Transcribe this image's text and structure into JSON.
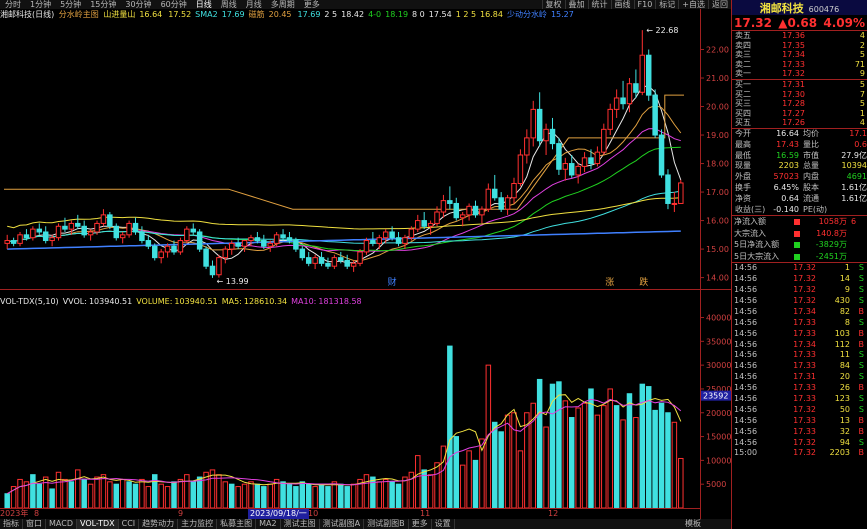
{
  "topbar": {
    "timeframes": [
      "分时",
      "1分钟",
      "5分钟",
      "15分钟",
      "30分钟",
      "60分钟",
      "日线",
      "周线",
      "月线",
      "多周期",
      "更多"
    ],
    "active_index": 6,
    "right_buttons": [
      "复权",
      "叠加",
      "统计",
      "画线",
      "F10",
      "标记",
      "+自选",
      "返回"
    ]
  },
  "legend": {
    "title": "湘邮科技(日线)",
    "indicator": "分水岭主图",
    "items": [
      {
        "label": "山进量山",
        "value": "16.64",
        "color": "#f0e040"
      },
      {
        "label": "",
        "value": "17.52",
        "color": "#f0e040"
      },
      {
        "label": "SMA2",
        "value": "17.69",
        "color": "#40e0e0"
      },
      {
        "label": "磁筋",
        "value": "20.45",
        "color": "#e0a040"
      },
      {
        "label": "",
        "value": "17.69",
        "color": "#40e0e0"
      },
      {
        "label": "2 5",
        "value": "18.42",
        "color": "#e8e8e8"
      },
      {
        "label": "4-0",
        "value": "18.19",
        "color": "#20d020"
      },
      {
        "label": "8 0",
        "value": "17.54",
        "color": "#e8e8e8"
      },
      {
        "label": "1 2 5",
        "value": "16.84",
        "color": "#f0e040"
      },
      {
        "label": "少动分水岭",
        "value": "15.27",
        "color": "#4080ff"
      }
    ]
  },
  "price_axis": [
    "22.00",
    "21.00",
    "20.00",
    "19.00",
    "18.00",
    "17.00",
    "16.00",
    "15.00",
    "14.00"
  ],
  "chart_annotations": {
    "high_label": "22.68",
    "low_label": "13.99"
  },
  "bottom_markers": [
    "财",
    "涨",
    "跌"
  ],
  "volume": {
    "legend": [
      {
        "label": "VOL-TDX(5,10)",
        "value": "",
        "color": "#e8e8e8"
      },
      {
        "label": "VVOL:",
        "value": "103940.51",
        "color": "#e8e8e8"
      },
      {
        "label": "VOLUME:",
        "value": "103940.51",
        "color": "#f0e040"
      },
      {
        "label": "MA5:",
        "value": "128610.34",
        "color": "#f0e040"
      },
      {
        "label": "MA10:",
        "value": "181318.58",
        "color": "#e040e0"
      }
    ],
    "axis": [
      "40000",
      "35000",
      "30000",
      "25000",
      "20000",
      "15000",
      "10000",
      "5000"
    ],
    "highlight": "23592"
  },
  "date_axis": [
    "2023年",
    "8",
    "9",
    "2023/09/18/一",
    "10",
    "11",
    "12"
  ],
  "bottom_tabs": [
    "指标",
    "窗口",
    "MACD",
    "VOL-TDX",
    "CCI",
    "趋势动力",
    "主力监控",
    "私募主图",
    "MA2",
    "测试主图",
    "测试副图A",
    "测试副图B",
    "更多",
    "设置"
  ],
  "bottom_tab_active": 3,
  "bottom_right": "模板",
  "stock": {
    "name": "湘邮科技",
    "code": "600476",
    "price": "17.32",
    "change": "▲0.68",
    "change_pct": "4.09%"
  },
  "asks": [
    {
      "label": "卖五",
      "price": "17.36",
      "vol": "4"
    },
    {
      "label": "卖四",
      "price": "17.35",
      "vol": "2"
    },
    {
      "label": "卖三",
      "price": "17.34",
      "vol": "5"
    },
    {
      "label": "卖二",
      "price": "17.33",
      "vol": "71"
    },
    {
      "label": "卖一",
      "price": "17.32",
      "vol": "9"
    }
  ],
  "bids": [
    {
      "label": "买一",
      "price": "17.31",
      "vol": "5"
    },
    {
      "label": "买二",
      "price": "17.30",
      "vol": "7"
    },
    {
      "label": "买三",
      "price": "17.28",
      "vol": "5"
    },
    {
      "label": "买四",
      "price": "17.27",
      "vol": "1"
    },
    {
      "label": "买五",
      "price": "17.26",
      "vol": "4"
    }
  ],
  "stats": [
    {
      "l1": "今开",
      "v1": "16.64",
      "c1": "#e8e8e8",
      "l2": "均价",
      "v2": "17.1",
      "c2": "#ff3030"
    },
    {
      "l1": "最高",
      "v1": "17.43",
      "c1": "#ff3030",
      "l2": "量比",
      "v2": "0.6",
      "c2": "#ff3030"
    },
    {
      "l1": "最低",
      "v1": "16.59",
      "c1": "#20d020",
      "l2": "市值",
      "v2": "27.9亿",
      "c2": "#e8e8e8"
    },
    {
      "l1": "现量",
      "v1": "2203",
      "c1": "#f0e040",
      "l2": "总量",
      "v2": "10394",
      "c2": "#f0e040"
    },
    {
      "l1": "外盘",
      "v1": "57023",
      "c1": "#ff3030",
      "l2": "内盘",
      "v2": "4691",
      "c2": "#20d020"
    },
    {
      "l1": "换手",
      "v1": "6.45%",
      "c1": "#e8e8e8",
      "l2": "股本",
      "v2": "1.61亿",
      "c2": "#e8e8e8"
    },
    {
      "l1": "净资",
      "v1": "0.64",
      "c1": "#e8e8e8",
      "l2": "流通",
      "v2": "1.61亿",
      "c2": "#e8e8e8"
    },
    {
      "l1": "收益(三)",
      "v1": "-0.140",
      "c1": "#e8e8e8",
      "l2": "PE(动)",
      "v2": "",
      "c2": "#e8e8e8"
    }
  ],
  "flows": [
    {
      "label": "净流入额",
      "bar": "#ff3030",
      "value": "1058万",
      "tail": "6",
      "color": "#ff3030"
    },
    {
      "label": "大宗流入",
      "bar": "#ff3030",
      "value": "140.8万",
      "tail": "",
      "color": "#ff3030"
    },
    {
      "label": "5日净流入额",
      "bar": "#20d020",
      "value": "-3829万",
      "tail": "",
      "color": "#20d020"
    },
    {
      "label": "5日大宗流入",
      "bar": "#20d020",
      "value": "-2451万",
      "tail": "",
      "color": "#20d020"
    }
  ],
  "ticks": [
    {
      "t": "14:56",
      "p": "17.32",
      "v": "1",
      "d": "S",
      "dc": "#20d020"
    },
    {
      "t": "14:56",
      "p": "17.32",
      "v": "14",
      "d": "S",
      "dc": "#20d020"
    },
    {
      "t": "14:56",
      "p": "17.32",
      "v": "9",
      "d": "S",
      "dc": "#20d020"
    },
    {
      "t": "14:56",
      "p": "17.32",
      "v": "430",
      "d": "S",
      "dc": "#20d020"
    },
    {
      "t": "14:56",
      "p": "17.34",
      "p_color": "#ff3030",
      "v": "82",
      "d": "B",
      "dc": "#ff3030"
    },
    {
      "t": "14:56",
      "p": "17.33",
      "v": "8",
      "d": "S",
      "dc": "#20d020"
    },
    {
      "t": "14:56",
      "p": "17.33",
      "v": "103",
      "d": "B",
      "dc": "#ff3030"
    },
    {
      "t": "14:56",
      "p": "17.34",
      "v": "112",
      "d": "B",
      "dc": "#ff3030"
    },
    {
      "t": "14:56",
      "p": "17.33",
      "v": "11",
      "d": "S",
      "dc": "#20d020"
    },
    {
      "t": "14:56",
      "p": "17.33",
      "v": "84",
      "d": "S",
      "dc": "#20d020"
    },
    {
      "t": "14:56",
      "p": "17.31",
      "v": "20",
      "d": "S",
      "dc": "#20d020"
    },
    {
      "t": "14:56",
      "p": "17.33",
      "v": "26",
      "d": "B",
      "dc": "#ff3030"
    },
    {
      "t": "14:56",
      "p": "17.33",
      "v": "123",
      "d": "S",
      "dc": "#20d020"
    },
    {
      "t": "14:56",
      "p": "17.32",
      "v": "50",
      "d": "S",
      "dc": "#20d020"
    },
    {
      "t": "14:56",
      "p": "17.33",
      "v": "13",
      "d": "B",
      "dc": "#ff3030"
    },
    {
      "t": "14:56",
      "p": "17.33",
      "v": "32",
      "d": "B",
      "dc": "#ff3030"
    },
    {
      "t": "14:56",
      "p": "17.32",
      "v": "94",
      "d": "S",
      "dc": "#20d020"
    },
    {
      "t": "15:00",
      "p": "17.32",
      "v": "2203",
      "d": "B",
      "dc": "#ff3030"
    }
  ],
  "candles": [
    [
      15.2,
      15.5,
      15.0,
      15.3
    ],
    [
      15.3,
      15.4,
      15.1,
      15.2
    ],
    [
      15.2,
      15.6,
      15.1,
      15.5
    ],
    [
      15.5,
      15.7,
      15.3,
      15.4
    ],
    [
      15.4,
      15.8,
      15.3,
      15.7
    ],
    [
      15.7,
      15.9,
      15.5,
      15.6
    ],
    [
      15.6,
      15.8,
      15.2,
      15.3
    ],
    [
      15.3,
      15.5,
      15.1,
      15.4
    ],
    [
      15.4,
      15.9,
      15.3,
      15.8
    ],
    [
      15.8,
      16.1,
      15.6,
      15.7
    ],
    [
      15.7,
      16.0,
      15.5,
      15.9
    ],
    [
      15.9,
      16.2,
      15.7,
      15.8
    ],
    [
      15.8,
      16.0,
      15.4,
      15.5
    ],
    [
      15.5,
      15.7,
      15.3,
      15.6
    ],
    [
      15.6,
      16.0,
      15.5,
      15.9
    ],
    [
      15.9,
      16.4,
      15.8,
      16.2
    ],
    [
      16.2,
      16.3,
      15.7,
      15.8
    ],
    [
      15.8,
      15.9,
      15.3,
      15.4
    ],
    [
      15.4,
      15.6,
      15.2,
      15.5
    ],
    [
      15.5,
      16.0,
      15.4,
      15.9
    ],
    [
      15.9,
      16.1,
      15.5,
      15.6
    ],
    [
      15.6,
      15.8,
      15.2,
      15.3
    ],
    [
      15.3,
      15.5,
      15.0,
      15.1
    ],
    [
      15.1,
      15.2,
      14.6,
      14.7
    ],
    [
      14.7,
      15.0,
      14.5,
      14.9
    ],
    [
      14.9,
      15.2,
      14.7,
      15.1
    ],
    [
      15.1,
      15.3,
      14.8,
      14.9
    ],
    [
      14.9,
      15.4,
      14.8,
      15.3
    ],
    [
      15.3,
      15.8,
      15.2,
      15.7
    ],
    [
      15.7,
      15.9,
      15.5,
      15.6
    ],
    [
      15.6,
      15.7,
      14.9,
      15.0
    ],
    [
      15.0,
      15.1,
      14.3,
      14.4
    ],
    [
      14.4,
      14.6,
      13.99,
      14.1
    ],
    [
      14.1,
      14.8,
      14.0,
      14.7
    ],
    [
      14.7,
      15.1,
      14.5,
      15.0
    ],
    [
      15.0,
      15.3,
      14.8,
      15.2
    ],
    [
      15.2,
      15.4,
      15.0,
      15.1
    ],
    [
      15.1,
      15.3,
      14.9,
      15.3
    ],
    [
      15.3,
      15.5,
      15.1,
      15.4
    ],
    [
      15.4,
      15.6,
      15.2,
      15.3
    ],
    [
      15.3,
      15.5,
      15.0,
      15.1
    ],
    [
      15.1,
      15.3,
      14.9,
      15.2
    ],
    [
      15.2,
      15.6,
      15.1,
      15.5
    ],
    [
      15.5,
      15.7,
      15.3,
      15.4
    ],
    [
      15.4,
      15.6,
      15.2,
      15.3
    ],
    [
      15.3,
      15.4,
      14.9,
      15.0
    ],
    [
      15.0,
      15.1,
      14.6,
      14.7
    ],
    [
      14.7,
      14.9,
      14.4,
      14.5
    ],
    [
      14.5,
      14.8,
      14.3,
      14.7
    ],
    [
      14.7,
      14.9,
      14.4,
      14.5
    ],
    [
      14.5,
      14.7,
      14.3,
      14.4
    ],
    [
      14.4,
      14.8,
      14.3,
      14.7
    ],
    [
      14.7,
      14.9,
      14.5,
      14.6
    ],
    [
      14.6,
      14.8,
      14.3,
      14.4
    ],
    [
      14.4,
      14.6,
      14.2,
      14.5
    ],
    [
      14.5,
      15.0,
      14.4,
      14.9
    ],
    [
      14.9,
      15.4,
      14.8,
      15.3
    ],
    [
      15.3,
      15.6,
      15.1,
      15.2
    ],
    [
      15.2,
      15.5,
      15.0,
      15.4
    ],
    [
      15.4,
      15.7,
      15.2,
      15.6
    ],
    [
      15.6,
      15.8,
      15.3,
      15.4
    ],
    [
      15.4,
      15.6,
      15.1,
      15.2
    ],
    [
      15.2,
      15.5,
      15.0,
      15.4
    ],
    [
      15.4,
      15.8,
      15.3,
      15.7
    ],
    [
      15.7,
      16.2,
      15.6,
      16.0
    ],
    [
      16.0,
      16.3,
      15.7,
      15.8
    ],
    [
      15.8,
      16.0,
      15.5,
      15.9
    ],
    [
      15.9,
      16.5,
      15.8,
      16.3
    ],
    [
      16.3,
      16.9,
      16.1,
      16.7
    ],
    [
      16.7,
      17.2,
      16.4,
      16.6
    ],
    [
      16.6,
      16.8,
      16.0,
      16.1
    ],
    [
      16.1,
      16.3,
      15.8,
      16.2
    ],
    [
      16.2,
      16.6,
      16.0,
      16.5
    ],
    [
      16.5,
      16.7,
      16.1,
      16.2
    ],
    [
      16.2,
      16.5,
      15.9,
      16.4
    ],
    [
      16.4,
      17.3,
      16.3,
      17.1
    ],
    [
      17.1,
      17.6,
      16.7,
      16.8
    ],
    [
      16.8,
      17.0,
      16.3,
      16.4
    ],
    [
      16.4,
      16.9,
      16.2,
      16.8
    ],
    [
      16.8,
      17.5,
      16.6,
      17.3
    ],
    [
      17.3,
      18.5,
      17.2,
      18.3
    ],
    [
      18.3,
      19.2,
      18.0,
      18.9
    ],
    [
      18.9,
      20.2,
      18.6,
      19.9
    ],
    [
      19.9,
      20.5,
      18.6,
      18.8
    ],
    [
      18.8,
      19.4,
      18.3,
      19.2
    ],
    [
      19.2,
      19.6,
      18.5,
      18.7
    ],
    [
      18.7,
      18.9,
      17.6,
      17.8
    ],
    [
      17.8,
      18.2,
      17.4,
      18.0
    ],
    [
      18.0,
      18.3,
      17.5,
      17.6
    ],
    [
      17.6,
      18.0,
      17.3,
      17.9
    ],
    [
      17.9,
      18.4,
      17.7,
      18.2
    ],
    [
      18.2,
      18.5,
      17.8,
      18.0
    ],
    [
      18.0,
      18.6,
      17.9,
      18.4
    ],
    [
      18.4,
      19.4,
      18.3,
      19.2
    ],
    [
      19.2,
      20.1,
      19.0,
      19.9
    ],
    [
      19.9,
      20.6,
      19.6,
      20.3
    ],
    [
      20.3,
      20.9,
      19.9,
      20.1
    ],
    [
      20.1,
      21.0,
      19.8,
      20.8
    ],
    [
      20.8,
      21.3,
      20.3,
      20.5
    ],
    [
      20.5,
      22.68,
      20.4,
      21.8
    ],
    [
      21.8,
      22.0,
      20.2,
      20.4
    ],
    [
      20.4,
      20.6,
      18.9,
      19.0
    ],
    [
      19.0,
      19.2,
      17.5,
      17.6
    ],
    [
      17.6,
      17.8,
      16.4,
      16.6
    ],
    [
      16.6,
      17.0,
      16.3,
      16.6
    ],
    [
      16.6,
      17.43,
      16.59,
      17.32
    ]
  ],
  "volumes": [
    3000,
    4500,
    6000,
    5500,
    7000,
    5000,
    6500,
    4000,
    7500,
    6000,
    5500,
    8000,
    6000,
    5000,
    6500,
    7000,
    5500,
    5000,
    6000,
    5500,
    5000,
    6000,
    4500,
    7000,
    5000,
    4500,
    5500,
    6000,
    7000,
    5500,
    6500,
    7500,
    8000,
    7000,
    5500,
    5000,
    4500,
    5000,
    5500,
    5000,
    4500,
    5000,
    6000,
    5500,
    5000,
    4500,
    5500,
    5000,
    4500,
    5000,
    4500,
    5500,
    5000,
    4500,
    5000,
    6000,
    7000,
    6500,
    5500,
    6000,
    5500,
    5000,
    6500,
    7500,
    11000,
    8000,
    7000,
    9500,
    13000,
    34000,
    15000,
    9000,
    12000,
    10000,
    14500,
    30000,
    18000,
    16000,
    19500,
    20000,
    12000,
    20000,
    22000,
    27000,
    17000,
    26000,
    26500,
    22500,
    19000,
    21000,
    22000,
    25000,
    19500,
    21500,
    25000,
    21500,
    18500,
    24000,
    19000,
    26000,
    25500,
    20500,
    22000,
    20000,
    18000,
    10400
  ],
  "vol_up": [
    false,
    true,
    true,
    true,
    false,
    false,
    true,
    false,
    true,
    true,
    false,
    true,
    false,
    true,
    true,
    true,
    true,
    false,
    true,
    false,
    false,
    true,
    true,
    false,
    true,
    true,
    false,
    true,
    true,
    false,
    false,
    true,
    true,
    true,
    true,
    false,
    true,
    true,
    true,
    false,
    false,
    true,
    true,
    false,
    false,
    false,
    false,
    false,
    true,
    false,
    false,
    true,
    false,
    false,
    true,
    true,
    true,
    false,
    true,
    true,
    false,
    false,
    true,
    true,
    true,
    false,
    true,
    true,
    true,
    false,
    false,
    true,
    true,
    false,
    true,
    true,
    false,
    false,
    true,
    true,
    true,
    true,
    true,
    false,
    true,
    false,
    false,
    true,
    false,
    true,
    true,
    false,
    true,
    true,
    true,
    false,
    true,
    false,
    true,
    false,
    false,
    false,
    false,
    false,
    true,
    true
  ]
}
